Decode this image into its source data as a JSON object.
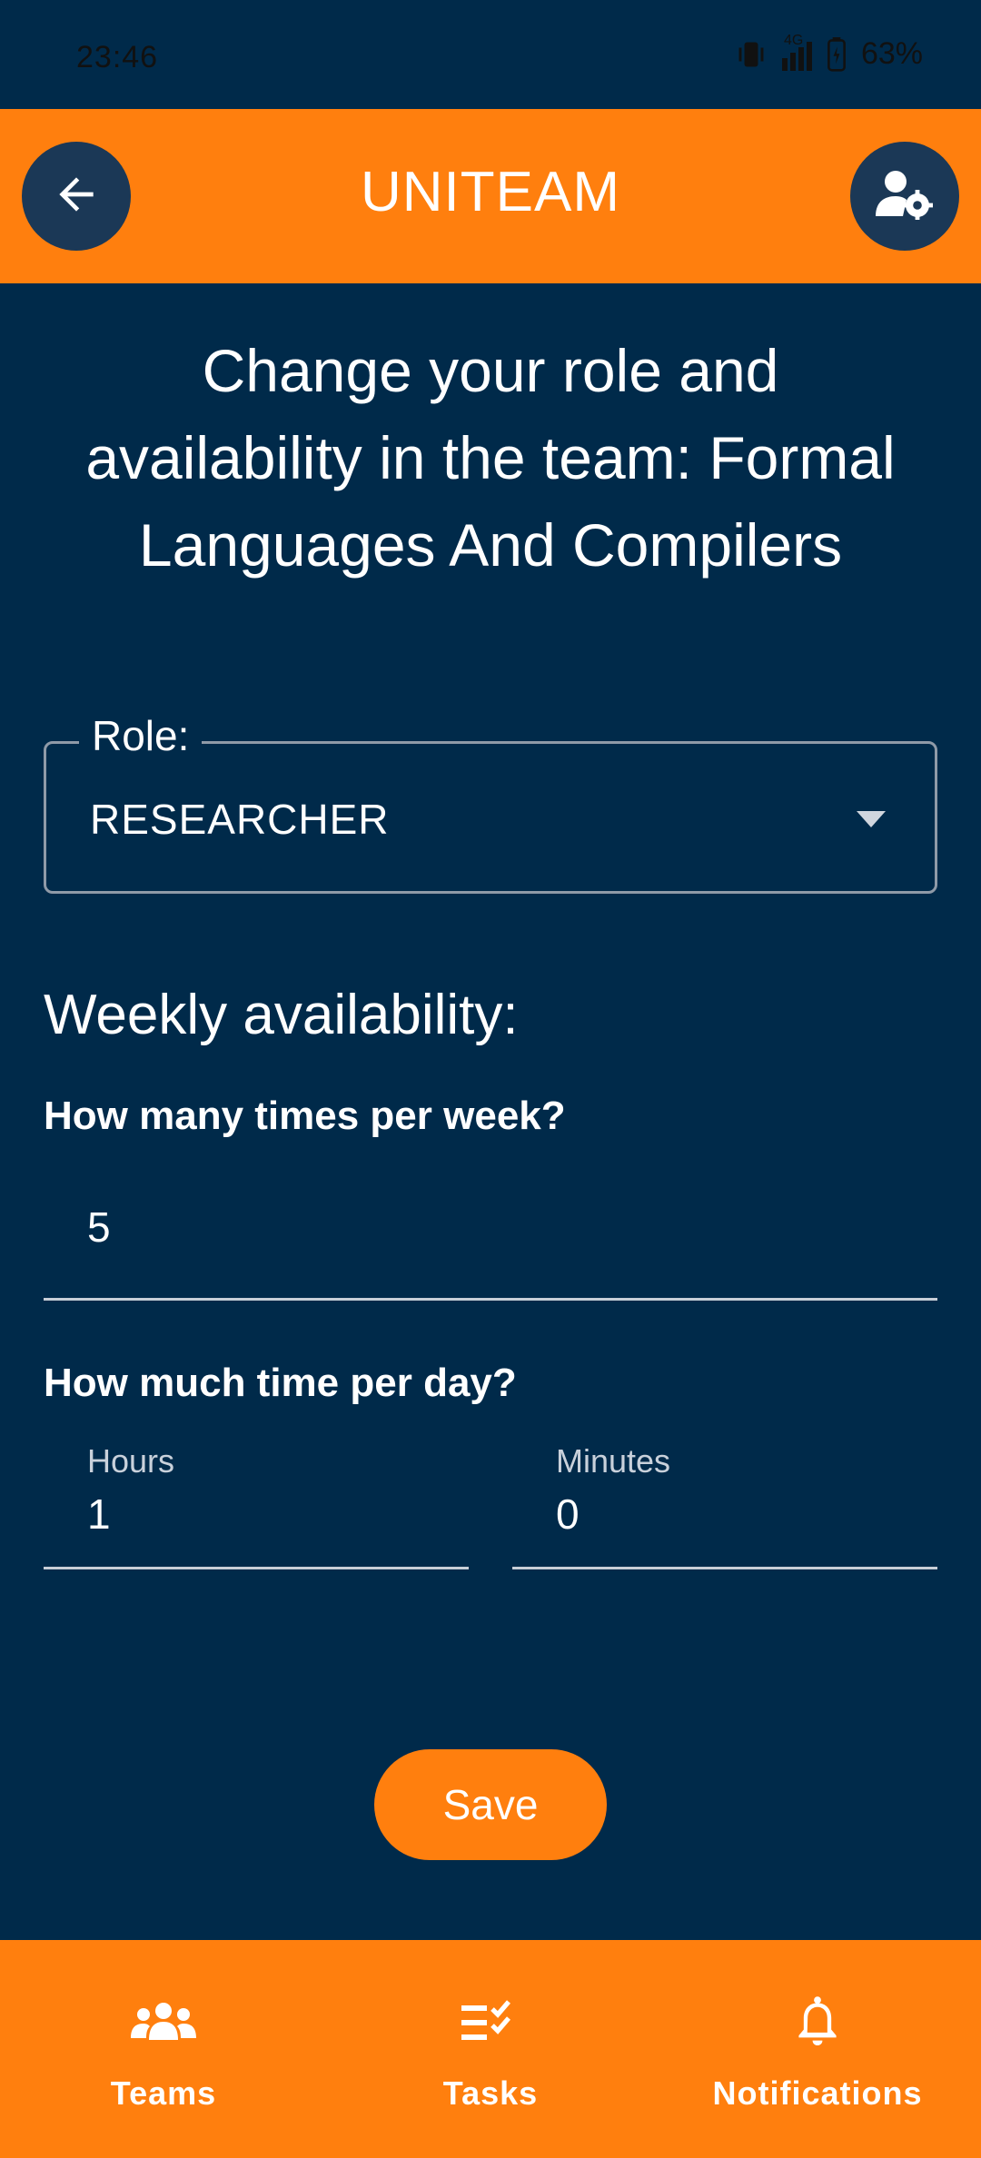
{
  "status_bar": {
    "time": "23:46",
    "battery": "63%",
    "network": "4G"
  },
  "app_bar": {
    "title": "UNITEAM"
  },
  "heading": "Change your role and availability in the team: Formal Languages And Compilers",
  "role": {
    "label": "Role:",
    "value": "RESEARCHER"
  },
  "availability": {
    "title": "Weekly availability:",
    "times_question": "How many times per week?",
    "times_value": "5",
    "time_question": "How much time per day?",
    "hours_label": "Hours",
    "hours_value": "1",
    "minutes_label": "Minutes",
    "minutes_value": "0"
  },
  "save_label": "Save",
  "bottom_nav": {
    "items": [
      {
        "label": "Teams",
        "icon": "teams-icon"
      },
      {
        "label": "Tasks",
        "icon": "tasks-icon"
      },
      {
        "label": "Notifications",
        "icon": "bell-icon"
      }
    ]
  },
  "colors": {
    "background": "#002a4a",
    "accent": "#ff7f0e",
    "button_circle": "#1b3856"
  }
}
